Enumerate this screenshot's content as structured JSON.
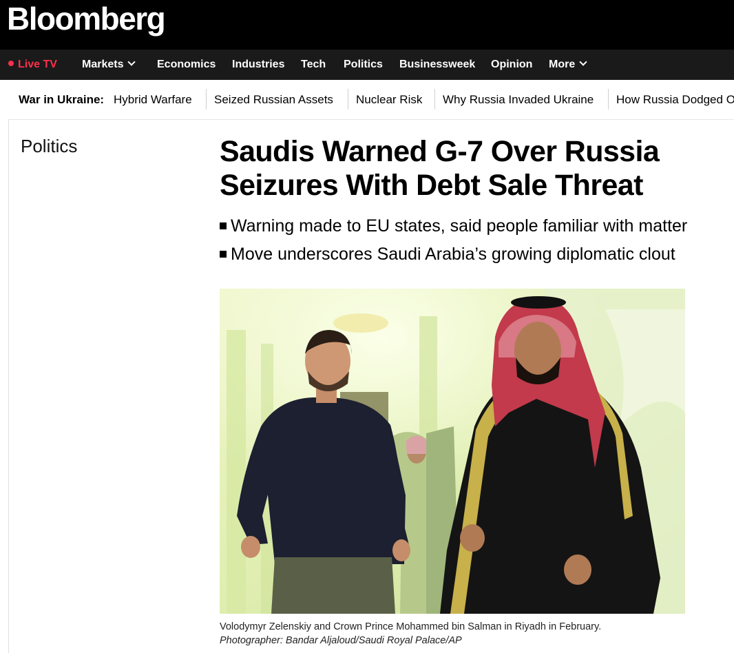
{
  "brand": {
    "logo": "Bloomberg"
  },
  "nav": {
    "live": "Live TV",
    "items": [
      "Markets",
      "Economics",
      "Industries",
      "Tech",
      "Politics",
      "Businessweek",
      "Opinion",
      "More"
    ]
  },
  "subnav": {
    "title": "War in Ukraine:",
    "links": [
      "Hybrid Warfare",
      "Seized Russian Assets",
      "Nuclear Risk",
      "Why Russia Invaded Ukraine",
      "How Russia Dodged Oil Sanctions"
    ]
  },
  "article": {
    "section": "Politics",
    "headline": "Saudis Warned G-7 Over Russia Seizures With Debt Sale Threat",
    "bullets": [
      "Warning made to EU states, said people familiar with matter",
      "Move underscores Saudi Arabia’s growing diplomatic clout"
    ],
    "caption": "Volodymyr Zelenskiy and Crown Prince Mohammed bin Salman in Riyadh in February.",
    "credit": "Photographer: Bandar Aljaloud/Saudi Royal Palace/AP"
  },
  "colors": {
    "brand_bg": "#000000",
    "nav_bg": "#1a1a1a",
    "live_red": "#ff2f4d"
  }
}
